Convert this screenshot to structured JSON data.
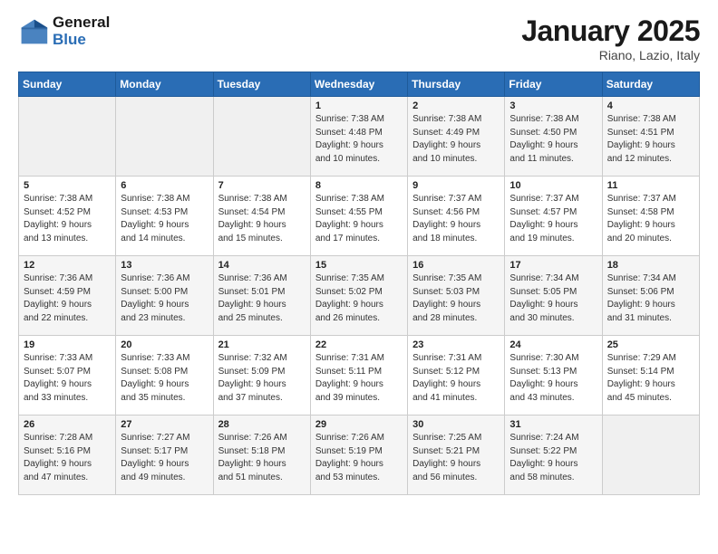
{
  "header": {
    "logo_general": "General",
    "logo_blue": "Blue",
    "month": "January 2025",
    "location": "Riano, Lazio, Italy"
  },
  "weekdays": [
    "Sunday",
    "Monday",
    "Tuesday",
    "Wednesday",
    "Thursday",
    "Friday",
    "Saturday"
  ],
  "weeks": [
    [
      {
        "day": "",
        "info": ""
      },
      {
        "day": "",
        "info": ""
      },
      {
        "day": "",
        "info": ""
      },
      {
        "day": "1",
        "info": "Sunrise: 7:38 AM\nSunset: 4:48 PM\nDaylight: 9 hours\nand 10 minutes."
      },
      {
        "day": "2",
        "info": "Sunrise: 7:38 AM\nSunset: 4:49 PM\nDaylight: 9 hours\nand 10 minutes."
      },
      {
        "day": "3",
        "info": "Sunrise: 7:38 AM\nSunset: 4:50 PM\nDaylight: 9 hours\nand 11 minutes."
      },
      {
        "day": "4",
        "info": "Sunrise: 7:38 AM\nSunset: 4:51 PM\nDaylight: 9 hours\nand 12 minutes."
      }
    ],
    [
      {
        "day": "5",
        "info": "Sunrise: 7:38 AM\nSunset: 4:52 PM\nDaylight: 9 hours\nand 13 minutes."
      },
      {
        "day": "6",
        "info": "Sunrise: 7:38 AM\nSunset: 4:53 PM\nDaylight: 9 hours\nand 14 minutes."
      },
      {
        "day": "7",
        "info": "Sunrise: 7:38 AM\nSunset: 4:54 PM\nDaylight: 9 hours\nand 15 minutes."
      },
      {
        "day": "8",
        "info": "Sunrise: 7:38 AM\nSunset: 4:55 PM\nDaylight: 9 hours\nand 17 minutes."
      },
      {
        "day": "9",
        "info": "Sunrise: 7:37 AM\nSunset: 4:56 PM\nDaylight: 9 hours\nand 18 minutes."
      },
      {
        "day": "10",
        "info": "Sunrise: 7:37 AM\nSunset: 4:57 PM\nDaylight: 9 hours\nand 19 minutes."
      },
      {
        "day": "11",
        "info": "Sunrise: 7:37 AM\nSunset: 4:58 PM\nDaylight: 9 hours\nand 20 minutes."
      }
    ],
    [
      {
        "day": "12",
        "info": "Sunrise: 7:36 AM\nSunset: 4:59 PM\nDaylight: 9 hours\nand 22 minutes."
      },
      {
        "day": "13",
        "info": "Sunrise: 7:36 AM\nSunset: 5:00 PM\nDaylight: 9 hours\nand 23 minutes."
      },
      {
        "day": "14",
        "info": "Sunrise: 7:36 AM\nSunset: 5:01 PM\nDaylight: 9 hours\nand 25 minutes."
      },
      {
        "day": "15",
        "info": "Sunrise: 7:35 AM\nSunset: 5:02 PM\nDaylight: 9 hours\nand 26 minutes."
      },
      {
        "day": "16",
        "info": "Sunrise: 7:35 AM\nSunset: 5:03 PM\nDaylight: 9 hours\nand 28 minutes."
      },
      {
        "day": "17",
        "info": "Sunrise: 7:34 AM\nSunset: 5:05 PM\nDaylight: 9 hours\nand 30 minutes."
      },
      {
        "day": "18",
        "info": "Sunrise: 7:34 AM\nSunset: 5:06 PM\nDaylight: 9 hours\nand 31 minutes."
      }
    ],
    [
      {
        "day": "19",
        "info": "Sunrise: 7:33 AM\nSunset: 5:07 PM\nDaylight: 9 hours\nand 33 minutes."
      },
      {
        "day": "20",
        "info": "Sunrise: 7:33 AM\nSunset: 5:08 PM\nDaylight: 9 hours\nand 35 minutes."
      },
      {
        "day": "21",
        "info": "Sunrise: 7:32 AM\nSunset: 5:09 PM\nDaylight: 9 hours\nand 37 minutes."
      },
      {
        "day": "22",
        "info": "Sunrise: 7:31 AM\nSunset: 5:11 PM\nDaylight: 9 hours\nand 39 minutes."
      },
      {
        "day": "23",
        "info": "Sunrise: 7:31 AM\nSunset: 5:12 PM\nDaylight: 9 hours\nand 41 minutes."
      },
      {
        "day": "24",
        "info": "Sunrise: 7:30 AM\nSunset: 5:13 PM\nDaylight: 9 hours\nand 43 minutes."
      },
      {
        "day": "25",
        "info": "Sunrise: 7:29 AM\nSunset: 5:14 PM\nDaylight: 9 hours\nand 45 minutes."
      }
    ],
    [
      {
        "day": "26",
        "info": "Sunrise: 7:28 AM\nSunset: 5:16 PM\nDaylight: 9 hours\nand 47 minutes."
      },
      {
        "day": "27",
        "info": "Sunrise: 7:27 AM\nSunset: 5:17 PM\nDaylight: 9 hours\nand 49 minutes."
      },
      {
        "day": "28",
        "info": "Sunrise: 7:26 AM\nSunset: 5:18 PM\nDaylight: 9 hours\nand 51 minutes."
      },
      {
        "day": "29",
        "info": "Sunrise: 7:26 AM\nSunset: 5:19 PM\nDaylight: 9 hours\nand 53 minutes."
      },
      {
        "day": "30",
        "info": "Sunrise: 7:25 AM\nSunset: 5:21 PM\nDaylight: 9 hours\nand 56 minutes."
      },
      {
        "day": "31",
        "info": "Sunrise: 7:24 AM\nSunset: 5:22 PM\nDaylight: 9 hours\nand 58 minutes."
      },
      {
        "day": "",
        "info": ""
      }
    ]
  ]
}
